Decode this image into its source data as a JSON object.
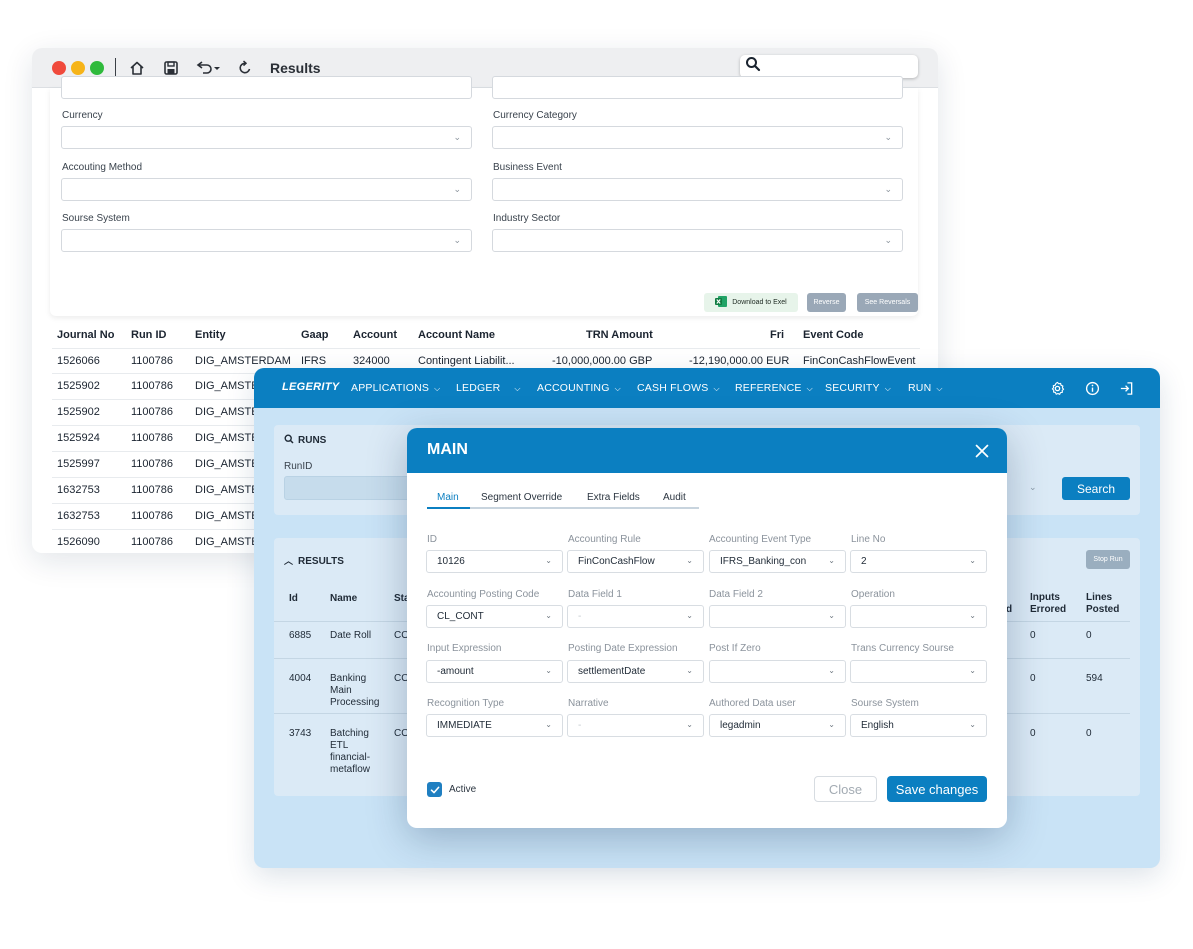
{
  "back_window": {
    "title": "Results",
    "filters": [
      {
        "label": "Currency",
        "value": ""
      },
      {
        "label": "Currency Category",
        "value": ""
      },
      {
        "label": "Accouting Method",
        "value": ""
      },
      {
        "label": "Business Event",
        "value": ""
      },
      {
        "label": "Sourse System",
        "value": ""
      },
      {
        "label": "Industry Sector",
        "value": ""
      }
    ],
    "actions": {
      "download": "Download to Exel",
      "reverse": "Reverse",
      "see_reversals": "See Reversals"
    },
    "journal_columns": [
      "Journal No",
      "Run ID",
      "Entity",
      "Gaap",
      "Account",
      "Account Name",
      "TRN Amount",
      "Fri",
      "Event Code"
    ],
    "journal_rows": [
      [
        "1526066",
        "1100786",
        "DIG_AMSTERDAM",
        "IFRS",
        "324000",
        "Contingent Liabilit...",
        "-10,000,000.00 GBP",
        "-12,190,000.00 EUR",
        "FinConCashFlowEvent"
      ],
      [
        "1525902",
        "1100786",
        "DIG_AMSTEF"
      ],
      [
        "1525902",
        "1100786",
        "DIG_AMSTEF"
      ],
      [
        "1525924",
        "1100786",
        "DIG_AMSTEF"
      ],
      [
        "1525997",
        "1100786",
        "DIG_AMSTEF"
      ],
      [
        "1632753",
        "1100786",
        "DIG_AMSTEF"
      ],
      [
        "1632753",
        "1100786",
        "DIG_AMSTEF"
      ],
      [
        "1526090",
        "1100786",
        "DIG_AMSTEF"
      ]
    ]
  },
  "app": {
    "brand": "LEGERITY",
    "nav": [
      "APPLICATIONS",
      "LEDGER",
      "ACCOUNTING",
      "CASH FLOWS",
      "REFERENCE",
      "SECURITY",
      "RUN"
    ],
    "runs": {
      "title": "RUNS",
      "field_label": "RunID",
      "search": "Search"
    },
    "results": {
      "title": "RESULTS",
      "stop_run": "Stop Run",
      "columns": {
        "id": "Id",
        "name": "Name",
        "status_partial": "Sta",
        "inputs_errored_partial": "d",
        "inputs_errored": "Inputs Errored",
        "lines_posted": "Lines Posted"
      },
      "rows": [
        {
          "id": "6885",
          "name": "Date Roll",
          "status": "CO",
          "inputs_errored": "0",
          "lines_posted": "0"
        },
        {
          "id": "4004",
          "name": "Banking Main Processing",
          "status": "CO",
          "inputs_errored": "0",
          "lines_posted": "594"
        },
        {
          "id": "3743",
          "name": "Batching ETL financial-metaflow",
          "status": "CO",
          "inputs_errored": "0",
          "lines_posted": "0"
        }
      ]
    }
  },
  "modal": {
    "title": "MAIN",
    "tabs": [
      "Main",
      "Segment Override",
      "Extra Fields",
      "Audit"
    ],
    "fields": [
      {
        "label": "ID",
        "value": "10126"
      },
      {
        "label": "Accounting Rule",
        "value": "FinConCashFlow"
      },
      {
        "label": "Accounting Event Type",
        "value": "IFRS_Banking_con"
      },
      {
        "label": "Line No",
        "value": "2"
      },
      {
        "label": "Accounting Posting Code",
        "value": "CL_CONT"
      },
      {
        "label": "Data Field 1",
        "value": "-"
      },
      {
        "label": "Data Field 2",
        "value": ""
      },
      {
        "label": "Operation",
        "value": ""
      },
      {
        "label": "Input Expression",
        "value": "-amount"
      },
      {
        "label": "Posting Date Expression",
        "value": "settlementDate"
      },
      {
        "label": "Post If Zero",
        "value": ""
      },
      {
        "label": "Trans Currency Sourse",
        "value": ""
      },
      {
        "label": "Recognition Type",
        "value": "IMMEDIATE"
      },
      {
        "label": "Narrative",
        "value": "-"
      },
      {
        "label": "Authored Data user",
        "value": "legadmin"
      },
      {
        "label": "Sourse System",
        "value": "English"
      }
    ],
    "active_label": "Active",
    "close": "Close",
    "save": "Save changes"
  },
  "colors": {
    "primary": "#0b7fc1",
    "app_bg": "#c9e3f6",
    "card_bg": "#dbeaf6"
  }
}
